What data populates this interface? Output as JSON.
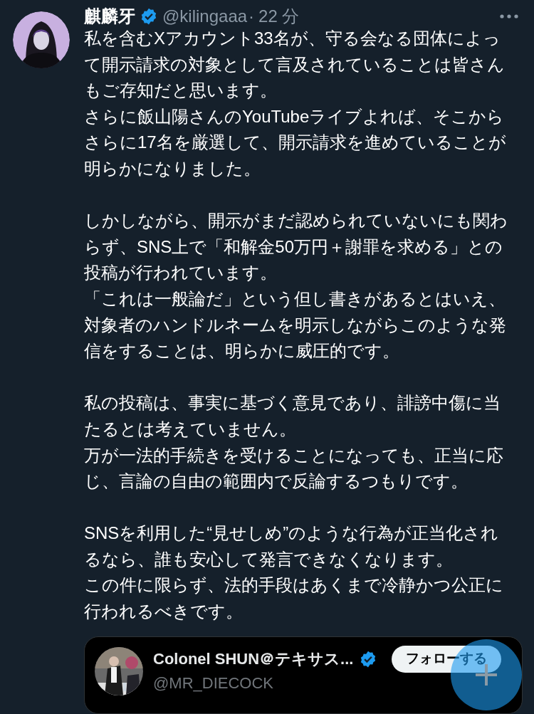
{
  "post": {
    "author": {
      "name": "麒麟牙",
      "verified": true,
      "handle": "@kilingaaa",
      "separator": "·",
      "time": "22 分"
    },
    "paragraphs": [
      [
        "私を含むXアカウント33名が、守る会なる団体によって開示請求の対象として言及されていることは皆さんもご存知だと思います。",
        "さらに飯山陽さんのYouTubeライブよれば、そこからさらに17名を厳選して、開示請求を進めていることが明らかになりました。"
      ],
      [
        "しかしながら、開示がまだ認められていないにも関わらず、SNS上で「和解金50万円＋謝罪を求める」との投稿が行われています。",
        "「これは一般論だ」という但し書きがあるとはいえ、対象者のハンドルネームを明示しながらこのような発信をすることは、明らかに威圧的です。"
      ],
      [
        "私の投稿は、事実に基づく意見であり、誹謗中傷に当たるとは考えていません。",
        "万が一法的手続きを受けることになっても、正当に応じ、言論の自由の範囲内で反論するつもりです。"
      ],
      [
        "SNSを利用した“見せしめ”のような行為が正当化されるなら、誰も安心して発言できなくなります。",
        "この件に限らず、法的手段はあくまで冷静かつ公正に行われるべきです。"
      ]
    ],
    "quoted": {
      "name": "Colonel SHUN＠テキサス...",
      "verified": true,
      "handle": "@MR_DIECOCK",
      "follow_button": "フォローする"
    }
  }
}
